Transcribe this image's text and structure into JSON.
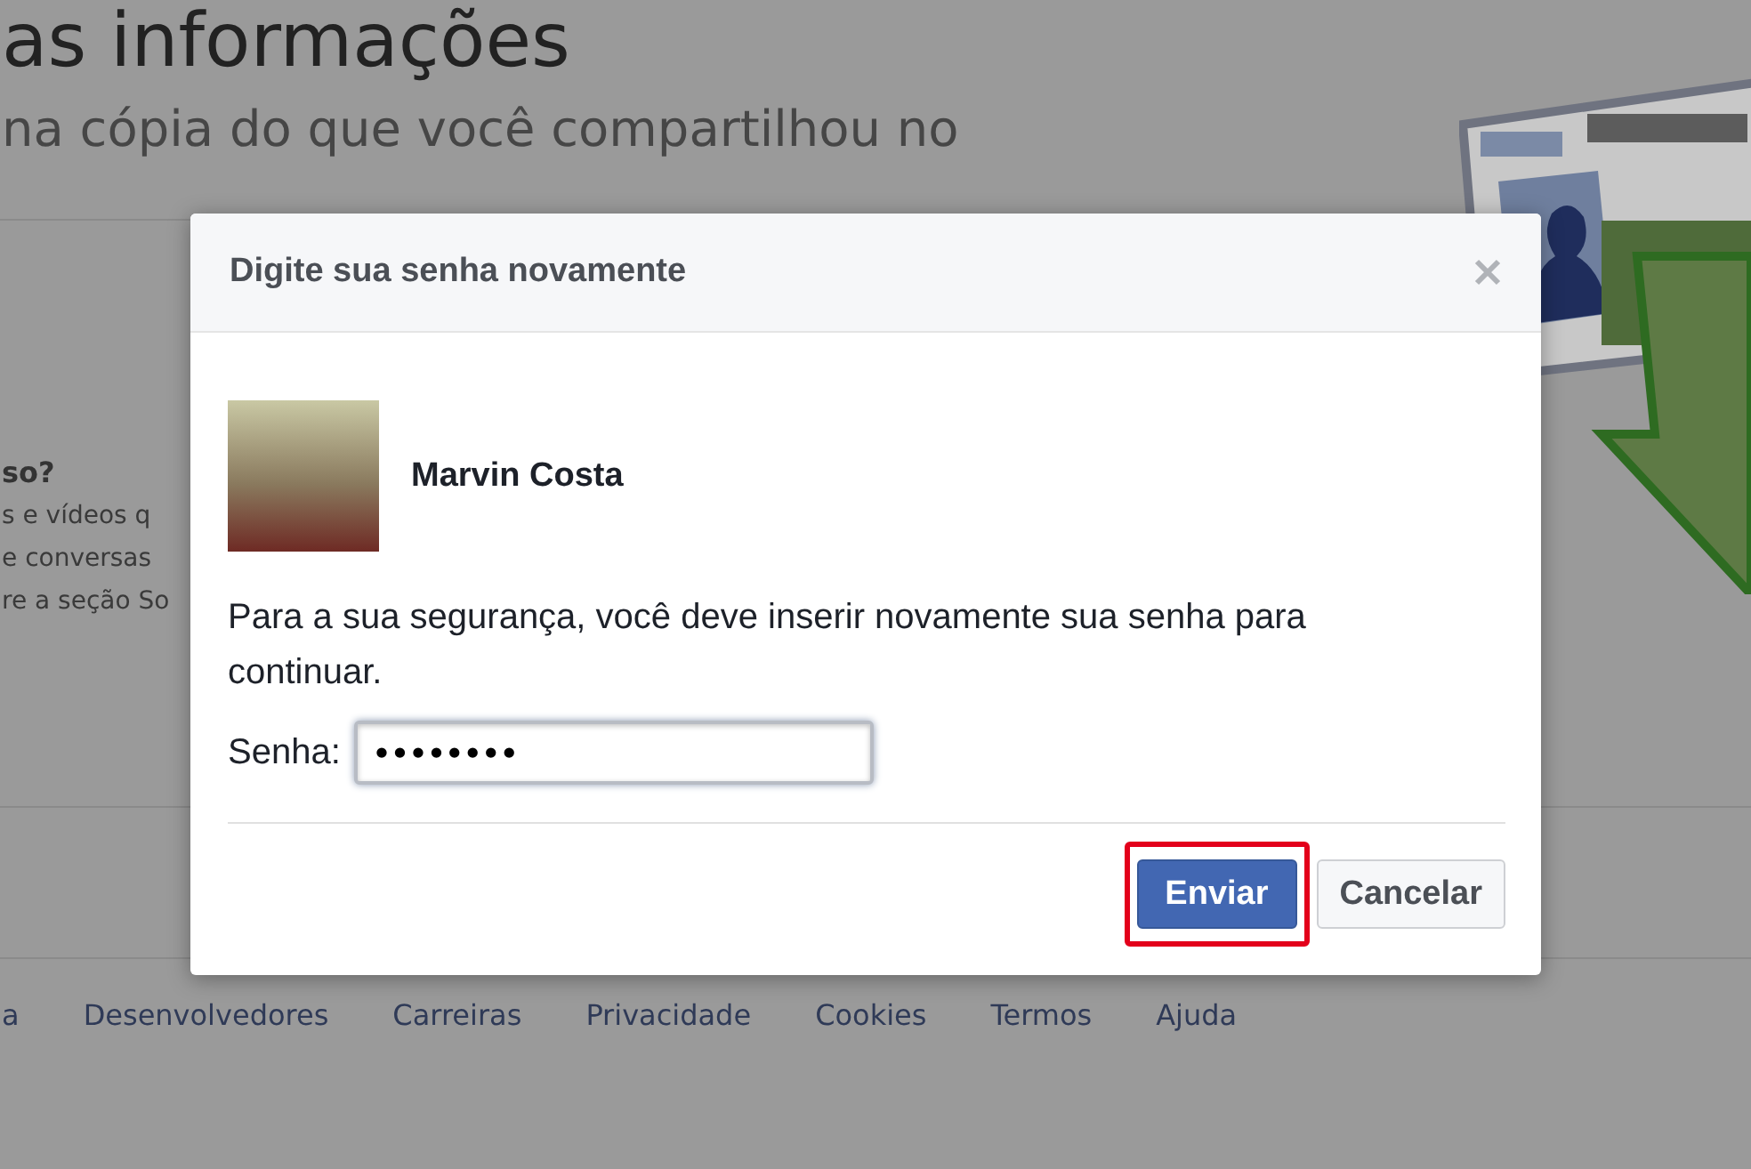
{
  "page": {
    "heading": "as informações",
    "subheading": "na cópia do que você compartilhou no",
    "side_title": "so?",
    "side_lines": [
      "s e vídeos q",
      "e conversas",
      "re a seção So"
    ]
  },
  "dialog": {
    "title": "Digite sua senha novamente",
    "user_name": "Marvin Costa",
    "message": "Para a sua segurança, você deve inserir novamente sua senha para continuar.",
    "password_label": "Senha:",
    "password_value": "••••••••",
    "buttons": [
      {
        "label": "Enviar",
        "kind": "primary",
        "highlighted": true
      },
      {
        "label": "Cancelar",
        "kind": "secondary",
        "highlighted": false
      }
    ]
  },
  "footer_links": [
    "a",
    "Desenvolvedores",
    "Carreiras",
    "Privacidade",
    "Cookies",
    "Termos",
    "Ajuda"
  ]
}
